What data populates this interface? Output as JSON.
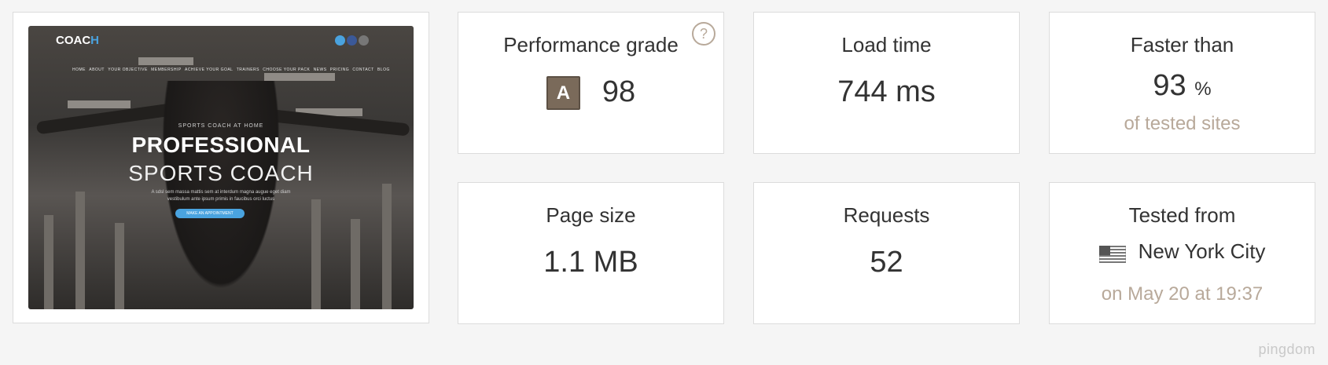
{
  "screenshot": {
    "logo_main": "COAC",
    "logo_accent": "H",
    "nav": [
      "HOME",
      "ABOUT",
      "YOUR OBJECTIVE",
      "MEMBERSHIP",
      "ACHIEVE YOUR GOAL",
      "TRAINERS",
      "CHOOSE YOUR PACK",
      "NEWS",
      "PRICING",
      "CONTACT",
      "BLOG"
    ],
    "kicker": "SPORTS COACH AT HOME",
    "headline": "PROFESSIONAL",
    "subheadline": "SPORTS COACH",
    "blurb": "A sdsl sem massa mattis sem at interdum magna augue eget diam vestibulum ante ipsum primis in faucibus orci luctus",
    "cta": "MAKE AN APPOINTMENT"
  },
  "performance": {
    "title": "Performance grade",
    "grade": "A",
    "score": "98",
    "help_icon": "question-circle-icon"
  },
  "load_time": {
    "title": "Load time",
    "value": "744 ms"
  },
  "faster_than": {
    "title": "Faster than",
    "value": "93",
    "unit": "%",
    "sub": "of tested sites"
  },
  "page_size": {
    "title": "Page size",
    "value": "1.1 MB"
  },
  "requests": {
    "title": "Requests",
    "value": "52"
  },
  "tested_from": {
    "title": "Tested from",
    "location": "New York City",
    "date": "on May 20 at 19:37",
    "flag_icon": "us-flag-icon"
  },
  "brand": "pingdom",
  "colors": {
    "accent_muted": "#b8a99a",
    "grade_badge": "#7a6a5a",
    "card_border": "#dcdcdc"
  }
}
